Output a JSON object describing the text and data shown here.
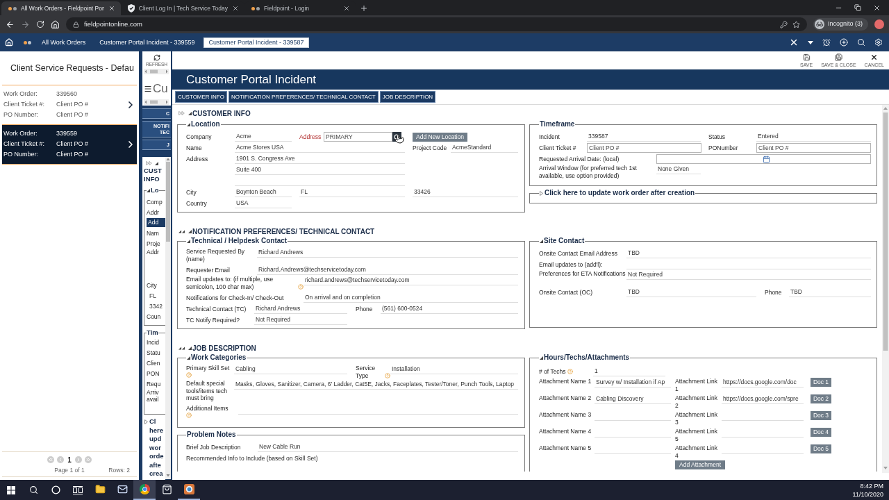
{
  "browser": {
    "tabs": [
      {
        "title": "All Work Orders - Fieldpoint Por",
        "kind": "dots",
        "selected": true
      },
      {
        "title": "Client Log In | Tech Service Today",
        "kind": "shield",
        "selected": false
      },
      {
        "title": "Fieldpoint - Login",
        "kind": "dots",
        "selected": false
      }
    ],
    "url": "fieldpointonline.com",
    "profile": "Incognito (3)"
  },
  "app_nav": {
    "items": [
      {
        "label": "All Work Orders",
        "selected": false
      },
      {
        "label": "Customer Portal Incident - 339559",
        "selected": false
      },
      {
        "label": "Customer Portal Incident - 339587",
        "selected": true
      }
    ]
  },
  "list_panel": {
    "title": "Client Service Requests - Defau",
    "items": [
      {
        "selected": false,
        "fields": [
          {
            "label": "Work Order:",
            "value": "339560"
          },
          {
            "label": "Client Ticket #:",
            "value": "Client PO #"
          },
          {
            "label": "PO Number:",
            "value": "Client PO #"
          }
        ]
      },
      {
        "selected": true,
        "fields": [
          {
            "label": "Work Order:",
            "value": "339559"
          },
          {
            "label": "Client Ticket #:",
            "value": "Client PO #"
          },
          {
            "label": "PO Number:",
            "value": "Client PO #"
          }
        ]
      }
    ],
    "pager": {
      "page": "1",
      "page_info": "Page 1 of 1",
      "rows": "Rows: 2"
    }
  },
  "background_window": {
    "refresh": "REFRESH",
    "title": "Cu",
    "tabs": [
      "C",
      "NOTIFI TEC",
      "J"
    ],
    "section": "CUST INFO",
    "expanded": true,
    "groups": [
      {
        "legend": "Lo",
        "expanded": true,
        "items": [
          {
            "text": "Comp",
            "kind": "label"
          },
          {
            "text": "Addr",
            "kind": "label"
          },
          {
            "text": "Add",
            "kind": "button"
          },
          {
            "text": "Nam",
            "kind": "label"
          },
          {
            "text": "Proje",
            "kind": "label"
          },
          {
            "text": "Addr",
            "kind": "label"
          },
          {
            "text": "City",
            "kind": "label"
          },
          {
            "text": "FL",
            "kind": "value"
          },
          {
            "text": "3342",
            "kind": "value"
          },
          {
            "text": "Coun",
            "kind": "label"
          }
        ]
      },
      {
        "legend": "Tim",
        "items": [
          {
            "text": "Incid",
            "kind": "label"
          },
          {
            "text": "Statu",
            "kind": "label"
          },
          {
            "text": "Clien",
            "kind": "label"
          },
          {
            "text": "PON",
            "kind": "label"
          },
          {
            "text": "Requ",
            "kind": "label"
          },
          {
            "text": "Arriv avail",
            "kind": "label"
          }
        ]
      },
      {
        "legend": "Cl here upd wor orde afte crea",
        "expanded": false
      }
    ]
  },
  "dialog": {
    "toolbar": [
      {
        "label": "SAVE",
        "kind": "save"
      },
      {
        "label": "SAVE & CLOSE",
        "kind": "save_close"
      },
      {
        "label": "CANCEL",
        "kind": "cancel"
      }
    ],
    "title": "Customer Portal Incident",
    "tabs": [
      "CUSTOMER INFO",
      "NOTIFICATION PREFERENCES/ TECHNICAL CONTACT",
      "JOB DESCRIPTION"
    ],
    "customer_info": {
      "heading": "CUSTOMER INFO",
      "expanded": true,
      "location": {
        "legend": "Location",
        "expanded": true,
        "company": {
          "label": "Company",
          "value": "Acme"
        },
        "address_select": {
          "label": "Address",
          "value": "PRIMARY",
          "required": true
        },
        "add_location": "Add New Location",
        "name": {
          "label": "Name",
          "value": "Acme Stores USA"
        },
        "project_code": {
          "label": "Project Code",
          "value": "AcmeStandard"
        },
        "address": {
          "label": "Address",
          "lines": [
            "1901 S. Congress Ave",
            "Suite 400"
          ]
        },
        "city": {
          "label": "City",
          "value": "Boynton Beach"
        },
        "state": "FL",
        "zip": "33426",
        "country": {
          "label": "Country",
          "value": "USA"
        }
      },
      "timeframe": {
        "legend": "Timeframe",
        "incident": {
          "label": "Incident",
          "value": "339587"
        },
        "status": {
          "label": "Status",
          "value": "Entered"
        },
        "client_ticket": {
          "label": "Client Ticket #",
          "value": "Client PO #"
        },
        "po_number": {
          "label": "PONumber",
          "value": "Client PO #"
        },
        "arrival_date": {
          "label": "Requested Arrival Date: (local)"
        },
        "arrival_window": {
          "label": "Arrival Window (for preferred tech 1st available, use option provided)",
          "value": "None Given"
        }
      },
      "update_group": {
        "legend": "Click here to update work order after creation",
        "expanded": false
      }
    },
    "notification": {
      "heading": "NOTIFICATION PREFERENCES/ TECHNICAL CONTACT",
      "expanded": true,
      "technical": {
        "legend": "Technical / Helpdesk Contact",
        "expanded": true,
        "requested_by": {
          "label": "Service Requested By (name)",
          "value": "Richard Andrews"
        },
        "requester_email": {
          "label": "Requester Email",
          "value": "Richard.Andrews@techservicetoday.com"
        },
        "email_updates": {
          "label": "Email updates to: (if multiple, use semicolon, 100 char max)",
          "help": true,
          "value": "richard.andrews@techservicetoday.com"
        },
        "check_in_notifications": {
          "label": "Notifications for Check-In/ Check-Out",
          "value": "On arrival and on completion"
        },
        "technical_contact": {
          "label": "Technical Contact (TC)",
          "value": "Richard Andrews"
        },
        "phone": {
          "label": "Phone",
          "value": "(561) 600-0524"
        },
        "tc_notify": {
          "label": "TC Notify Required?",
          "value": "Not Required"
        }
      },
      "site_contact": {
        "legend": "Site Contact",
        "expanded": true,
        "email": {
          "label": "Onsite Contact Email Address",
          "value": "TBD"
        },
        "email_updates": {
          "label": "Email updates to (add'l):"
        },
        "eta_preferences": {
          "label": "Preferences for ETA Notifications",
          "value": "Not Required"
        },
        "onsite_contact": {
          "label": "Onsite Contact (OC)",
          "value": "TBD"
        },
        "phone": {
          "label": "Phone",
          "value": "TBD"
        }
      }
    },
    "job_description": {
      "heading": "JOB DESCRIPTION",
      "expanded": true,
      "work_categories": {
        "legend": "Work Categories",
        "expanded": true,
        "skill_set": {
          "label": "Primary Skill Set",
          "help": true,
          "value": "Cabling"
        },
        "service_type": {
          "label": "Service Type",
          "help": true,
          "value": "Installation"
        },
        "tools": {
          "label": "Default special tools/items tech must bring",
          "value": "Masks, Gloves, Sanitizer, Camera, 6' Ladder, Cat5E, Jacks, Faceplates, Tester/Toner, Punch Tools, Laptop"
        },
        "additional_items": {
          "label": "Additional Items",
          "help": true
        }
      },
      "problem_notes": {
        "legend": "Problem Notes",
        "brief_description": {
          "label": "Brief Job Description",
          "value": "New Cable Run"
        },
        "recommended_info": {
          "label": "Recommended Info to Include (based on Skill Set)"
        }
      },
      "hours": {
        "legend": "Hours/Techs/Attachments",
        "expanded": true,
        "techs": {
          "label": "# of Techs",
          "help": true,
          "value": "1"
        },
        "attachments": [
          {
            "name_label": "Attachment Name 1",
            "name": "Survey w/ Installation if Ap",
            "link_label": "Attachment Link 1",
            "link": "https://docs.google.com/doc",
            "button": "Doc 1"
          },
          {
            "name_label": "Attachment Name 2",
            "name": "Cabling Discovery",
            "link_label": "Attachment Link 2",
            "link": "https://docs.google.com/spre",
            "button": "Doc 2"
          },
          {
            "name_label": "Attachment Name 3",
            "link_label": "Attachment Link 3",
            "button": "Doc 3"
          },
          {
            "name_label": "Attachment Name 4",
            "link_label": "Attachment Link 5",
            "button": "Doc 4"
          },
          {
            "name_label": "Attachment Name 5",
            "link_label": "Attachment Link 4",
            "button": "Doc 5"
          }
        ],
        "add_button": "Add Attachment"
      }
    }
  },
  "taskbar": {
    "apps": [
      {
        "kind": "explorer",
        "active": false,
        "running": false
      },
      {
        "kind": "mail",
        "active": false,
        "running": false
      },
      {
        "kind": "browser",
        "active": true,
        "running": true
      },
      {
        "kind": "store",
        "active": false,
        "running": false
      },
      {
        "kind": "app",
        "active": false,
        "running": true
      }
    ],
    "time": "8:42 PM",
    "date": "11/10/2020"
  }
}
